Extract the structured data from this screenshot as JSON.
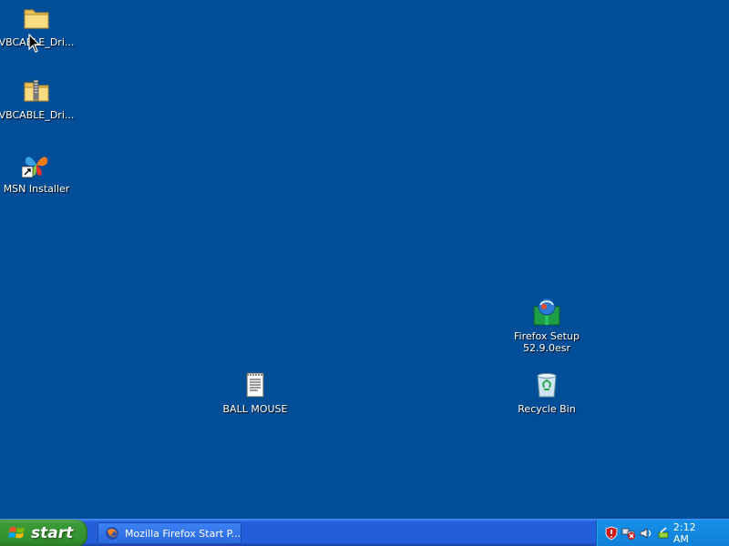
{
  "desktop": {
    "icons": [
      {
        "label": "VBCABLE_Dri...",
        "icon": "folder-icon"
      },
      {
        "label": "VBCABLE_Dri...",
        "icon": "zip-folder-icon"
      },
      {
        "label": "MSN Installer",
        "icon": "msn-butterfly-icon"
      },
      {
        "label": "Firefox Setup\n52.9.0esr",
        "icon": "installer-icon"
      },
      {
        "label": "BALL MOUSE",
        "icon": "text-document-icon"
      },
      {
        "label": "Recycle Bin",
        "icon": "recycle-bin-icon"
      }
    ],
    "background_color": "#004e98"
  },
  "taskbar": {
    "start_label": "start",
    "tasks": [
      {
        "label": "Mozilla Firefox Start P...",
        "icon": "firefox-icon"
      }
    ],
    "tray": {
      "icons": [
        "shield-alert-icon",
        "network-disconnected-icon",
        "volume-icon",
        "safely-remove-icon"
      ],
      "clock": "2:12 AM"
    }
  }
}
